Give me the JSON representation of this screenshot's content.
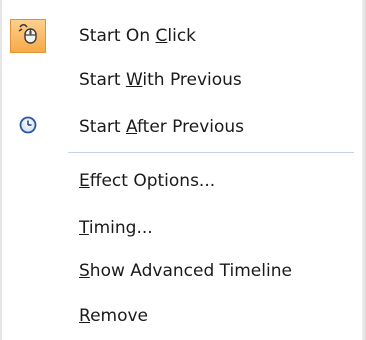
{
  "menu": {
    "items": [
      {
        "pre": "Start On ",
        "key": "C",
        "post": "lick",
        "icon": "mouse-click-icon",
        "checked": true
      },
      {
        "pre": "Start ",
        "key": "W",
        "post": "ith Previous",
        "icon": "",
        "checked": false
      },
      {
        "pre": "Start ",
        "key": "A",
        "post": "fter Previous",
        "icon": "clock-icon",
        "checked": false
      },
      {
        "pre": "",
        "key": "E",
        "post": "ffect Options...",
        "icon": "",
        "checked": false
      },
      {
        "pre": "",
        "key": "T",
        "post": "iming...",
        "icon": "",
        "checked": false
      },
      {
        "pre": "",
        "key": "S",
        "post": "how Advanced Timeline",
        "icon": "",
        "checked": false
      },
      {
        "pre": "",
        "key": "R",
        "post": "emove",
        "icon": "",
        "checked": false
      }
    ]
  },
  "colors": {
    "checked_bg": "#f7a949",
    "separator": "#c5d2e8",
    "clock_ring": "#2b57a6"
  }
}
